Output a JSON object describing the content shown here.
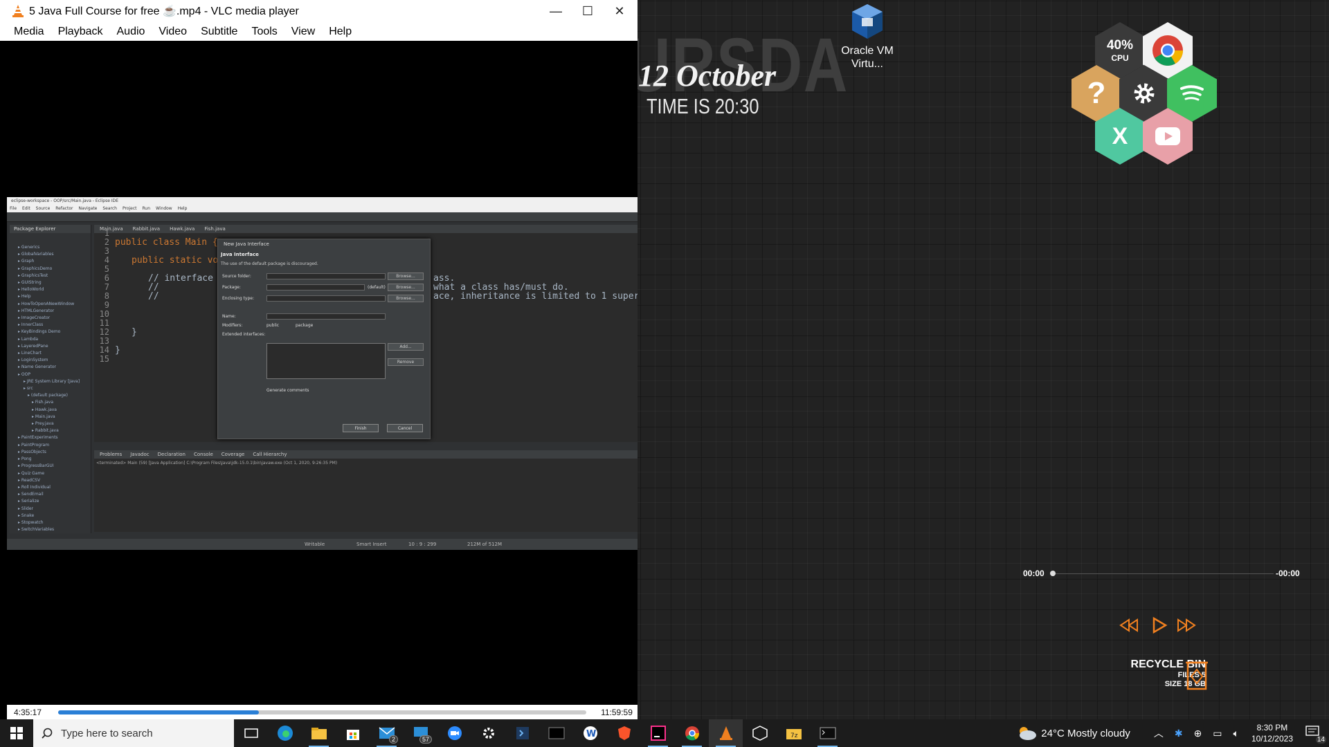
{
  "vlc": {
    "title": "5 Java Full Course for free ☕.mp4 - VLC media player",
    "menu": [
      "Media",
      "Playback",
      "Audio",
      "Video",
      "Subtitle",
      "Tools",
      "View",
      "Help"
    ],
    "elapsed": "4:35:17",
    "total": "11:59:59",
    "progress": 0.38
  },
  "eclipse": {
    "window_title": "eclipse-workspace - OOP/src/Main.java - Eclipse IDE",
    "menu": [
      "File",
      "Edit",
      "Source",
      "Refactor",
      "Navigate",
      "Search",
      "Project",
      "Run",
      "Window",
      "Help"
    ],
    "package_explorer_title": "Package Explorer",
    "packages": [
      "Generics",
      "GlobalVariables",
      "Graph",
      "GraphicsDemo",
      "GraphicsTest",
      "GUIString",
      "HelloWorld",
      "Help",
      "HowToOpenANewWindow",
      "HTMLGenerator",
      "ImageCreator",
      "InnerClass",
      "KeyBindings Demo",
      "Lambda",
      "LayeredPane",
      "LineChart",
      "LoginSystem",
      "Name Generator",
      "OOP",
      "JRE System Library [Java]",
      "src",
      "(default package)",
      "Fish.java",
      "Hawk.java",
      "Main.java",
      "Prey.java",
      "Rabbit.java",
      "PaintExperiments",
      "PaintProgram",
      "PassObjects",
      "Pong",
      "ProgressBarGUI",
      "Quiz Game",
      "ReadCSV",
      "Roll Individual",
      "SendEmail",
      "Serialize",
      "Slider",
      "Snake",
      "Stopwatch",
      "SwitchVariables"
    ],
    "tabs": [
      "Main.java",
      "Rabbit.java",
      "Hawk.java",
      "Fish.java"
    ],
    "line_numbers": [
      "1",
      "2",
      "3",
      "4",
      "5",
      "6",
      "7",
      "8",
      "9",
      "10",
      "11",
      "12",
      "13",
      "14",
      "15"
    ],
    "code": {
      "l2": "public class Main {",
      "l4": "public static voi",
      "l6": "// interface",
      "l7": "//",
      "l8": "//",
      "l12": "}",
      "l14": "}",
      "r6": "ass.",
      "r7": "what a class has/must do.",
      "r8": "ace, inheritance is limited to 1 super"
    },
    "console_tabs": [
      "Problems",
      "Javadoc",
      "Declaration",
      "Console",
      "Coverage",
      "Call Hierarchy"
    ],
    "console_text": "<terminated> Main (59) [Java Application] C:\\Program Files\\Java\\jdk-15.0.1\\bin\\javaw.exe (Oct 1, 2020, 9:26:35 PM)",
    "status": [
      "Writable",
      "Smart Insert",
      "10 : 9 : 299",
      "212M of 512M"
    ],
    "dialog": {
      "title": "New Java Interface",
      "heading": "Java Interface",
      "warning": "The use of the default package is discouraged.",
      "labels": [
        "Source folder:",
        "Package:",
        "Enclosing type:",
        "Name:",
        "Modifiers:",
        "Extended interfaces:"
      ],
      "default_tag": "(default)",
      "buttons": [
        "Browse...",
        "Browse...",
        "Browse...",
        "Add...",
        "Remove"
      ],
      "modifiers": [
        "public",
        "package"
      ],
      "generate": "Generate comments",
      "finish": "Finish",
      "cancel": "Cancel"
    }
  },
  "desktop": {
    "watermark": "URSDA",
    "date": "12 October",
    "time": "TIME IS 20:30",
    "icon_label": "Oracle VM Virtu...",
    "cpu_pct": "40%",
    "cpu_label": "CPU",
    "x_label": "X",
    "media_left": "00:00",
    "media_right": "-00:00",
    "recycle_title": "RECYCLE BIN",
    "recycle_files": "FILES 5",
    "recycle_size": "SIZE 18 GB"
  },
  "taskbar": {
    "search_placeholder": "Type here to search",
    "mail_badge": "2",
    "chat_badge": "57",
    "weather": "24°C  Mostly cloudy",
    "time": "8:30 PM",
    "date": "10/12/2023",
    "notif": "14",
    "accent": "#76b9ed"
  }
}
